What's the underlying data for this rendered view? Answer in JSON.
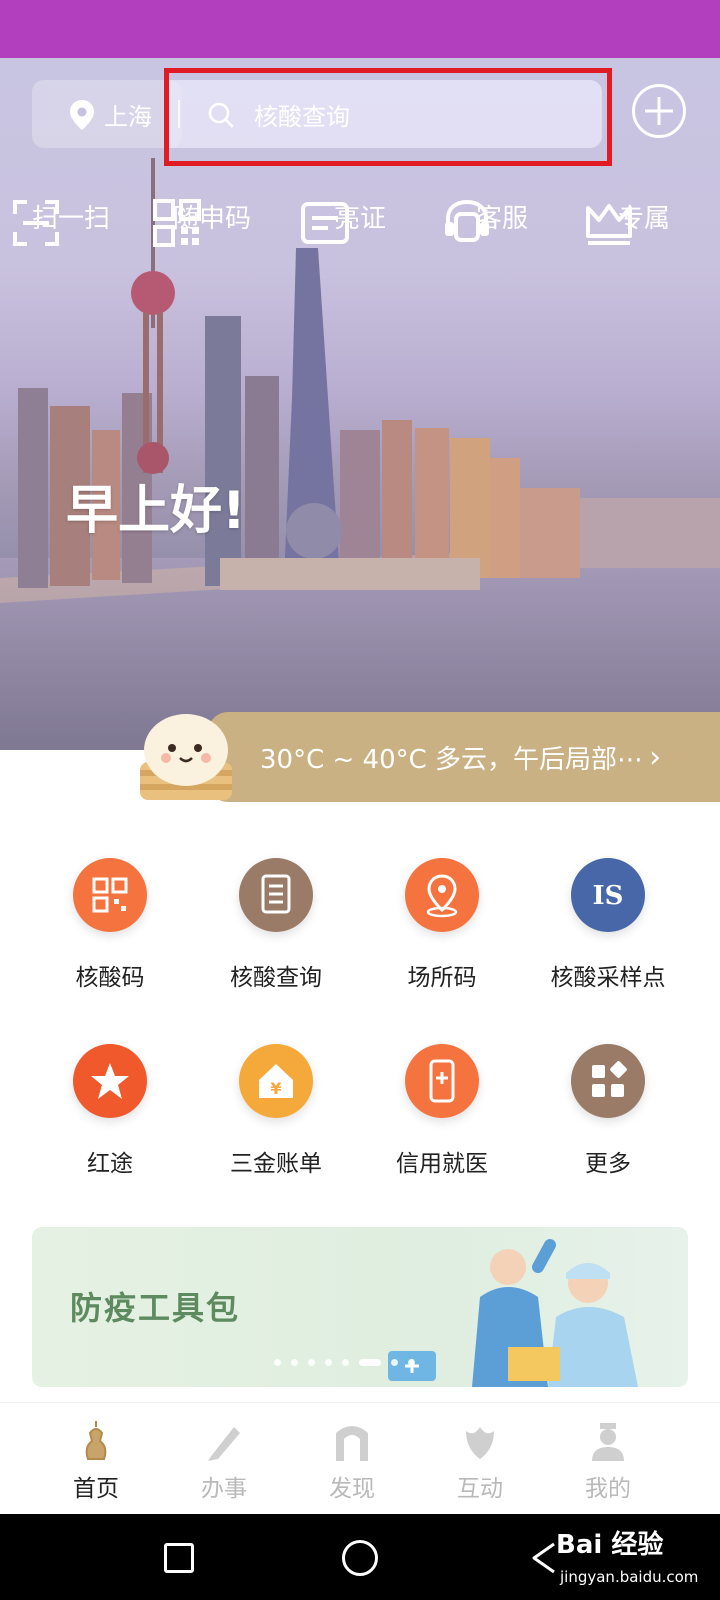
{
  "header": {
    "location": "上海",
    "search_placeholder": "核酸查询"
  },
  "quick_actions": [
    {
      "label": "扫一扫",
      "icon": "scan-icon"
    },
    {
      "label": "随申码",
      "icon": "qr-code-icon"
    },
    {
      "label": "亮证",
      "icon": "card-icon"
    },
    {
      "label": "客服",
      "icon": "headset-icon"
    },
    {
      "label": "专属",
      "icon": "crown-icon"
    }
  ],
  "greeting": "早上好!",
  "weather": "30°C ~ 40°C  多云，午后局部⋯",
  "services": [
    {
      "label": "核酸码",
      "icon": "qr-code-icon",
      "color": "#f5733f"
    },
    {
      "label": "核酸查询",
      "icon": "document-icon",
      "color": "#9a7b67"
    },
    {
      "label": "场所码",
      "icon": "location-pin-icon",
      "color": "#f5733f"
    },
    {
      "label": "核酸采样点",
      "icon": "sampling-site-icon",
      "color": "#4767a8"
    },
    {
      "label": "红途",
      "icon": "star-icon",
      "color": "#f0592b"
    },
    {
      "label": "三金账单",
      "icon": "yuan-house-icon",
      "color": "#f6a93b"
    },
    {
      "label": "信用就医",
      "icon": "phone-medical-icon",
      "color": "#f5733f"
    },
    {
      "label": "更多",
      "icon": "more-grid-icon",
      "color": "#9a7b67"
    }
  ],
  "banner": {
    "title": "防疫工具包"
  },
  "tabbar": [
    {
      "label": "首页",
      "icon": "pagoda-icon",
      "active": true
    },
    {
      "label": "办事",
      "icon": "pen-icon",
      "active": false
    },
    {
      "label": "发现",
      "icon": "arch-icon",
      "active": false
    },
    {
      "label": "互动",
      "icon": "magnolia-icon",
      "active": false
    },
    {
      "label": "我的",
      "icon": "person-icon",
      "active": false
    }
  ],
  "watermark": {
    "brand": "Bai 经验",
    "url": "jingyan.baidu.com"
  }
}
